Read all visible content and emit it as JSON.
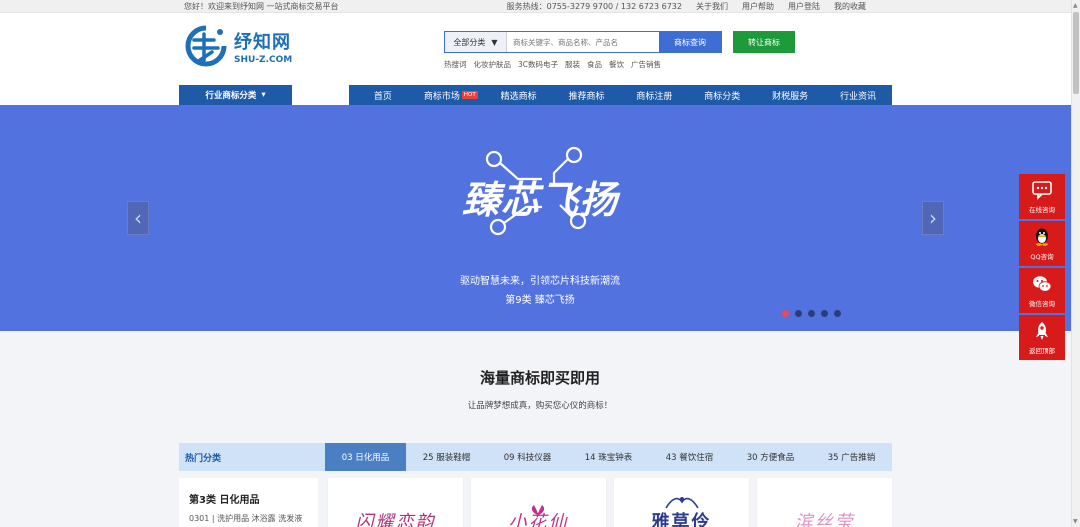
{
  "topbar": {
    "welcome": "您好！欢迎来到纾知网 一站式商标交易平台",
    "hotline": "服务热线：0755-3279 9700 / 132 6723 6732",
    "links": [
      "关于我们",
      "用户帮助",
      "用户登陆",
      "我的收藏"
    ]
  },
  "logo": {
    "cn": "纾知网",
    "en": "SHU-Z.COM"
  },
  "search": {
    "category": "全部分类",
    "placeholder": "商标关键字、商品名称、产品名",
    "button": "商标查询",
    "sell_button": "转让商标",
    "hotwords": [
      "热搜词",
      "化妆护肤品",
      "3C数码电子",
      "服装",
      "食品",
      "餐饮",
      "广告销售"
    ]
  },
  "nav": {
    "category_menu": "行业商标分类",
    "links": [
      "首页",
      "商标市场",
      "精选商标",
      "推荐商标",
      "商标注册",
      "商标分类",
      "财税服务",
      "行业资讯"
    ],
    "hot_badge": "HOT"
  },
  "banner": {
    "title": "臻芯飞扬",
    "line1": "驱动智慧未来，引领芯片科技新潮流",
    "line2": "第9类 臻芯飞扬",
    "slide_count": 5,
    "active_slide": 1
  },
  "section": {
    "heading": "海量商标即买即用",
    "subheading": "让品牌梦想成真，购买您心仪的商标！",
    "tabs_label": "热门分类",
    "tabs": [
      "03 日化用品",
      "25 服装鞋帽",
      "09 科技仪器",
      "14 珠宝钟表",
      "43 餐饮住宿",
      "30 方便食品",
      "35 广告推销"
    ],
    "active_tab": 0
  },
  "category_card": {
    "title": "第3类 日化用品",
    "desc": "0301 | 洗护用品 沐浴露 洗发液"
  },
  "trademarks": [
    {
      "text": "闪耀恋韵",
      "color": "#b0347a"
    },
    {
      "text": "小花仙",
      "color": "#c0318a"
    },
    {
      "text": "雅草伶",
      "color": "#2c3d8f"
    },
    {
      "text": "滨丝莹",
      "color": "#d992c4"
    }
  ],
  "side_tools": [
    "在线咨询",
    "QQ咨询",
    "微信咨询",
    "返回顶部"
  ],
  "colors": {
    "brand_blue": "#1e5aa8",
    "banner_bg": "#5272e0",
    "sell_green": "#1f9a3a",
    "side_red": "#d71a1a"
  }
}
